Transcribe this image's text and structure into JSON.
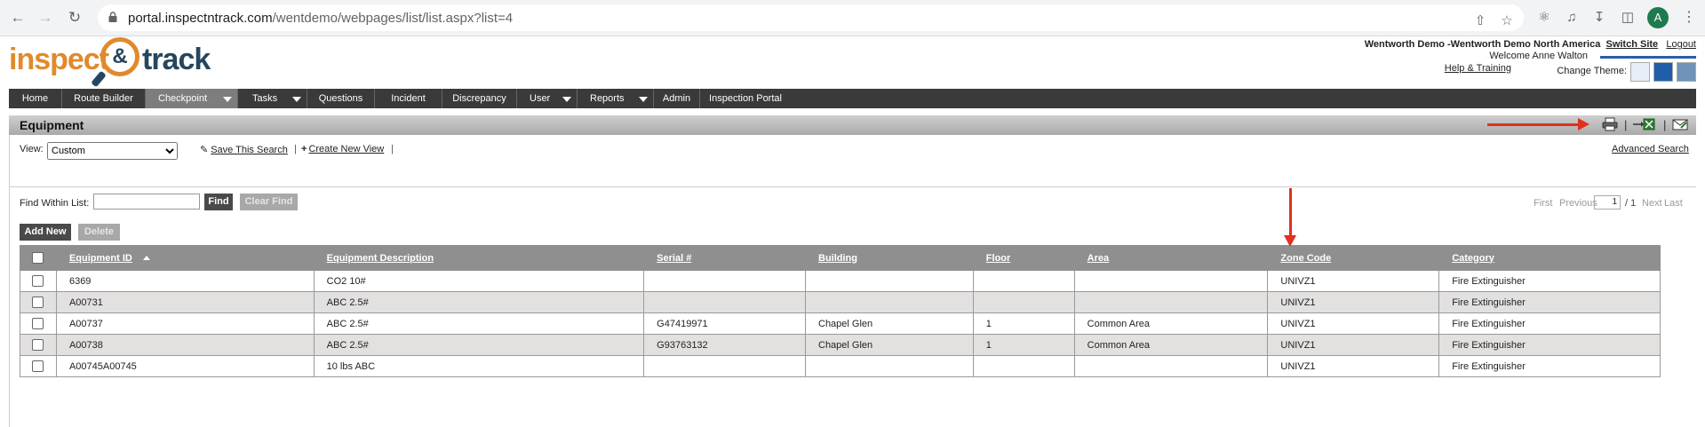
{
  "browser": {
    "url_domain": "portal.inspectntrack.com",
    "url_path": "/wentdemo/webpages/list/list.aspx?list=4",
    "avatar_letter": "A"
  },
  "header": {
    "logo_left": "inspect",
    "logo_amp": "&",
    "logo_right": "track",
    "site_name": "Wentworth Demo -Wentworth Demo North America",
    "switch_site": "Switch Site",
    "logout": "Logout",
    "welcome": "Welcome Anne Walton",
    "help": "Help & Training",
    "change_theme": "Change Theme:",
    "theme_colors": [
      "#e8eef7",
      "#1f5ea8",
      "#6f93b8"
    ]
  },
  "menu": {
    "items": [
      {
        "label": "Home"
      },
      {
        "label": "Route Builder"
      },
      {
        "label": "Checkpoint"
      },
      {
        "label": "Tasks"
      },
      {
        "label": "Questions"
      },
      {
        "label": "Incident"
      },
      {
        "label": "Discrepancy"
      },
      {
        "label": "User"
      },
      {
        "label": "Reports"
      },
      {
        "label": "Admin"
      },
      {
        "label": "Inspection Portal"
      }
    ]
  },
  "section": {
    "title": "Equipment",
    "view_label": "View:",
    "view_selected": "Custom",
    "save_search": "Save This Search",
    "create_view": "Create New View",
    "advanced_search": "Advanced Search"
  },
  "find": {
    "label": "Find Within List:",
    "find_btn": "Find",
    "clear_btn": "Clear Find",
    "add_new": "Add New",
    "delete": "Delete"
  },
  "pager": {
    "first": "First",
    "previous": "Previous",
    "page": "1",
    "of": "/ 1",
    "next": "Next",
    "last": "Last"
  },
  "table": {
    "columns": [
      "Equipment ID",
      "Equipment Description",
      "Serial #",
      "Building",
      "Floor",
      "Area",
      "Zone Code",
      "Category"
    ],
    "rows": [
      [
        "6369",
        "CO2 10#",
        "",
        "",
        "",
        "",
        "UNIVZ1",
        "Fire Extinguisher"
      ],
      [
        "A00731",
        "ABC 2.5#",
        "",
        "",
        "",
        "",
        "UNIVZ1",
        "Fire Extinguisher"
      ],
      [
        "A00737",
        "ABC 2.5#",
        "G47419971",
        "Chapel Glen",
        "1",
        "Common Area",
        "UNIVZ1",
        "Fire Extinguisher"
      ],
      [
        "A00738",
        "ABC 2.5#",
        "G93763132",
        "Chapel Glen",
        "1",
        "Common Area",
        "UNIVZ1",
        "Fire Extinguisher"
      ],
      [
        "A00745A00745",
        "10 lbs ABC",
        "",
        "",
        "",
        "",
        "UNIVZ1",
        "Fire Extinguisher"
      ]
    ]
  },
  "annotation_color": "#e0301e"
}
